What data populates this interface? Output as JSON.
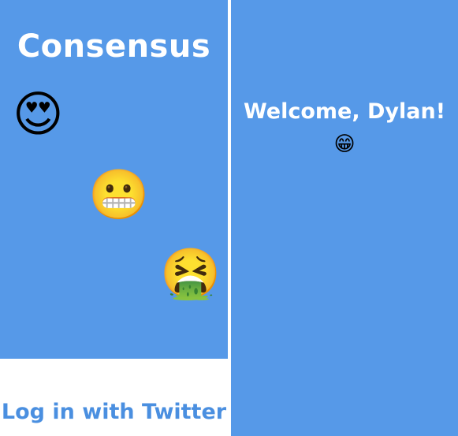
{
  "login_screen": {
    "title": "Consensus",
    "emojis": [
      "😍",
      "😬",
      "🤮"
    ],
    "emoji_names": [
      "heart-eyes-emoji",
      "grimacing-emoji",
      "vomiting-emoji"
    ],
    "login_label": "Log in with Twitter"
  },
  "welcome_screen": {
    "greeting": "Welcome, Dylan!",
    "emoji": "😁",
    "emoji_name": "grinning-emoji"
  },
  "colors": {
    "background_blue": "#5699e8",
    "button_text_blue": "#4a8fe0",
    "white": "#ffffff"
  }
}
